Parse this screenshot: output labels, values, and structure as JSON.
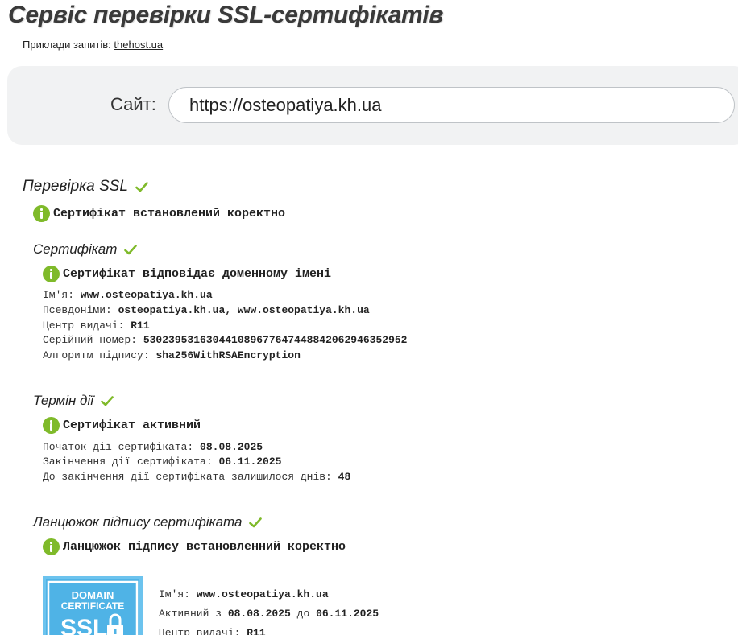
{
  "header": {
    "title": "Сервіс перевірки SSL-сертифікатів",
    "examples_label": "Приклади запитів:",
    "examples_link": "thehost.ua"
  },
  "search": {
    "label": "Сайт:",
    "value": "https://osteopatiya.kh.ua"
  },
  "ssl_check": {
    "heading": "Перевірка SSL",
    "status": "Сертифікат встановлений коректно"
  },
  "certificate": {
    "heading": "Сертифікат",
    "status": "Сертифікат відповідає доменному імені",
    "rows": [
      {
        "label": "Ім'я: ",
        "value": "www.osteopatiya.kh.ua"
      },
      {
        "label": "Псевдоніми: ",
        "value": "osteopatiya.kh.ua, www.osteopatiya.kh.ua"
      },
      {
        "label": "Центр видачі: ",
        "value": "R11"
      },
      {
        "label": "Серійний номер: ",
        "value": "530239531630441089677647448842062946352952"
      },
      {
        "label": "Алгоритм підпису: ",
        "value": "sha256WithRSAEncryption"
      }
    ]
  },
  "validity": {
    "heading": "Термін дії",
    "status": "Сертифікат активний",
    "rows": [
      {
        "label": "Початок дії сертифіката: ",
        "value": "08.08.2025"
      },
      {
        "label": "Закінчення дії сертифіката: ",
        "value": "06.11.2025"
      },
      {
        "label": "До закінчення дії сертифіката залишилося днів: ",
        "value": "48"
      }
    ]
  },
  "chain": {
    "heading": "Ланцюжок підпису сертифіката",
    "status": "Ланцюжок підпису встановленний коректно",
    "badge": {
      "line1": "DOMAIN",
      "line2": "CERTIFICATE",
      "line3": "SSL"
    },
    "rows": [
      {
        "label": "Ім'я: ",
        "value": "www.osteopatiya.kh.ua"
      },
      {
        "label": "Активний з ",
        "value": "08.08.2025",
        "label2": " до ",
        "value2": "06.11.2025"
      },
      {
        "label": "Центр видачі: ",
        "value": "R11"
      }
    ]
  },
  "colors": {
    "accent_green": "#7fba2a",
    "badge_blue": "#4fb3e6",
    "panel_bg": "#f1f2f3"
  }
}
